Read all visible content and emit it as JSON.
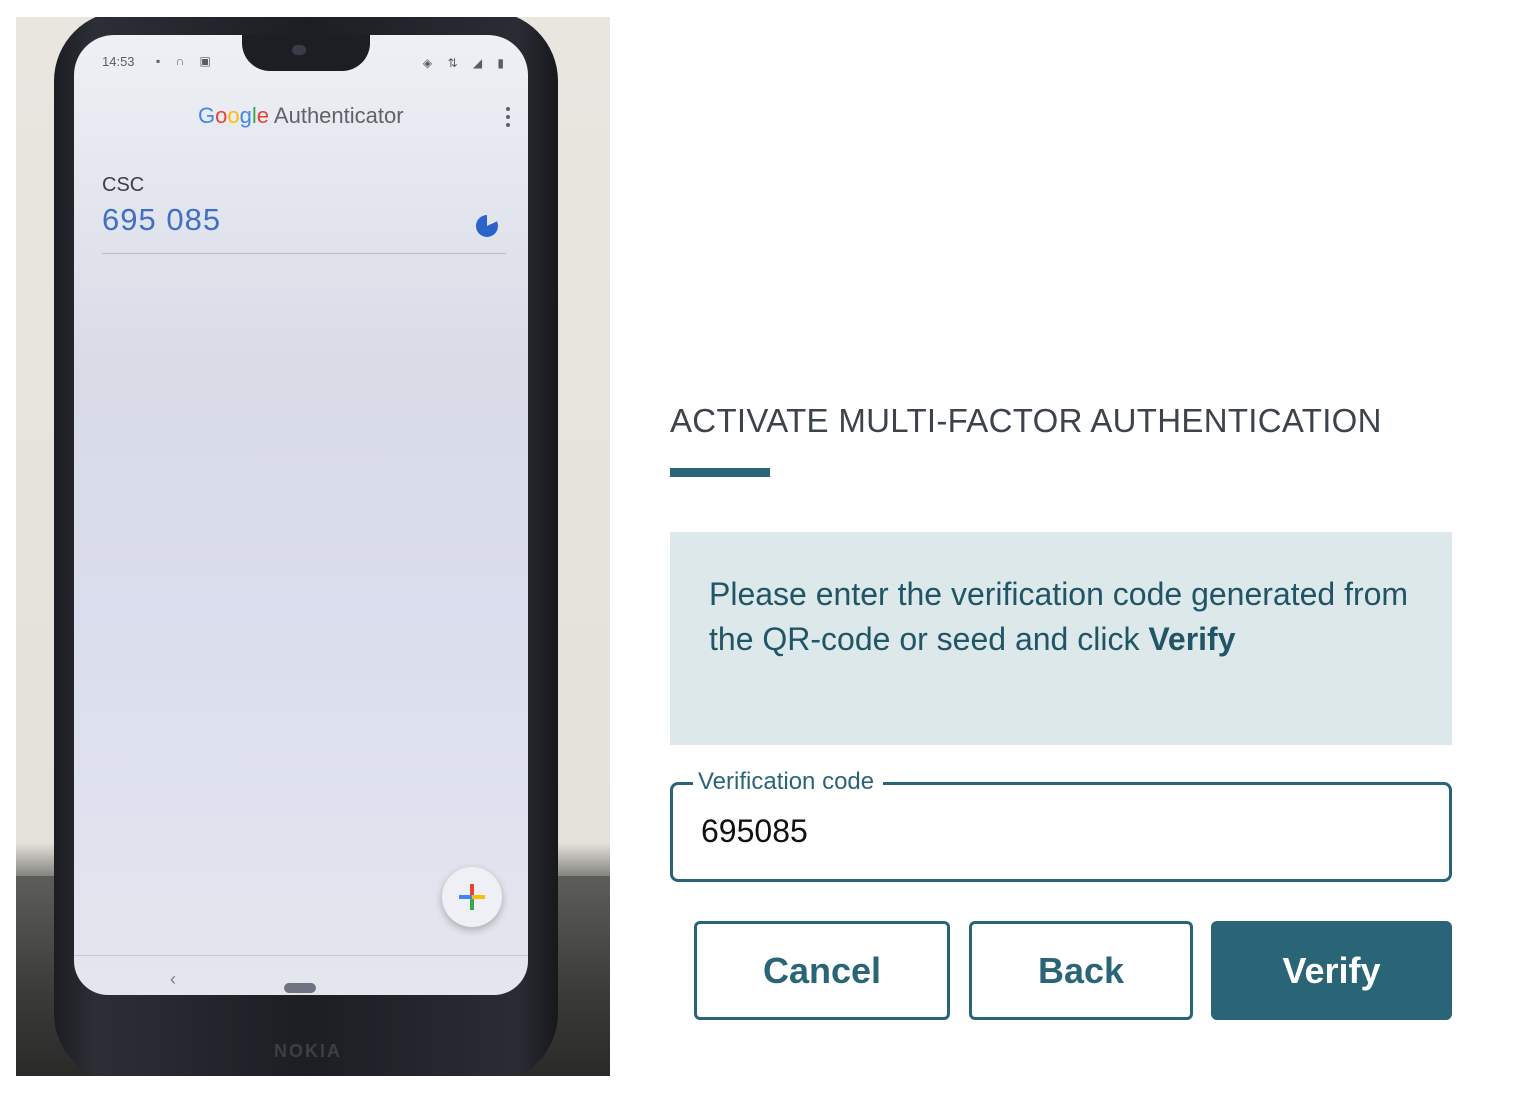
{
  "phone": {
    "status_time": "14:53",
    "app_title_brand": [
      "G",
      "o",
      "o",
      "g",
      "l",
      "e"
    ],
    "app_title_product": "Authenticator",
    "account_name": "CSC",
    "otp_code": "695 085",
    "device_brand": "NOKIA"
  },
  "dialog": {
    "title": "ACTIVATE MULTI-FACTOR AUTHENTICATION",
    "info_text": "Please enter the verification code generated from the QR-code or seed and click ",
    "info_bold": "Verify",
    "field_label": "Verification code",
    "field_value": "695085",
    "cancel_label": "Cancel",
    "back_label": "Back",
    "verify_label": "Verify"
  },
  "colors": {
    "accent": "#2a6577",
    "info_bg": "#dce8ea",
    "otp_blue": "#3f6fc7"
  }
}
